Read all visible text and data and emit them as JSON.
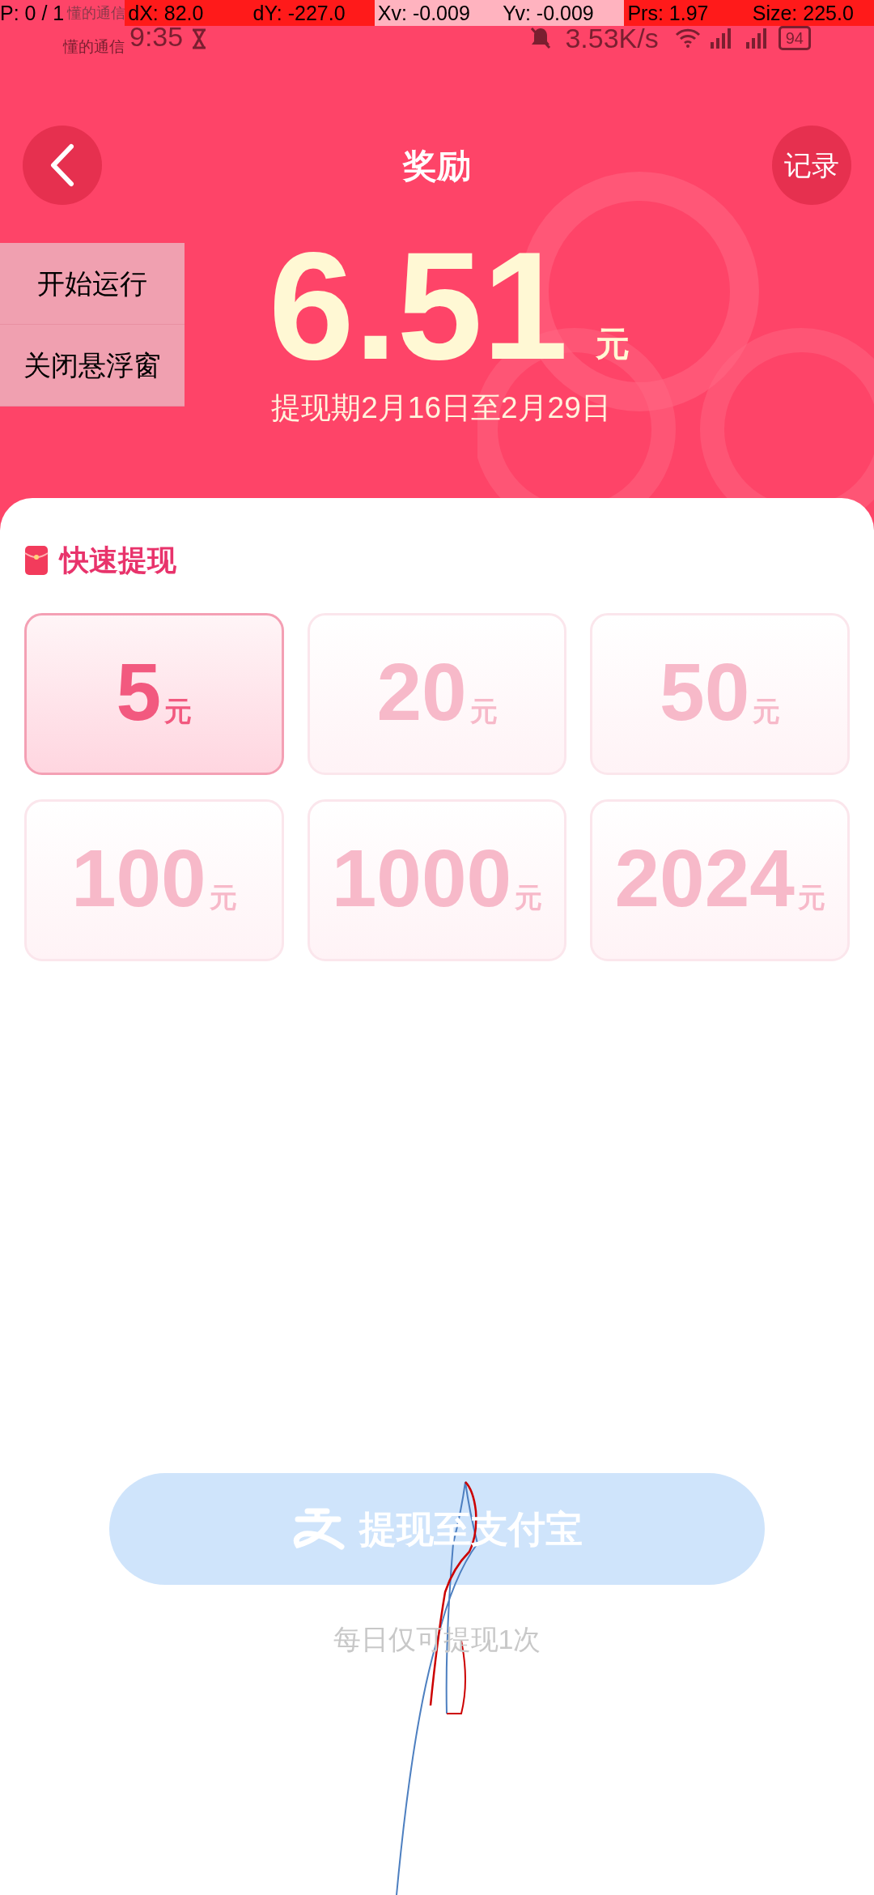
{
  "pointer_overlay": {
    "pointer": "P: 0 / 1",
    "carrier_behind": "懂的通信",
    "fields": [
      {
        "text": "dX: 82.0",
        "color": "#ff1a1a"
      },
      {
        "text": "dY: -227.0",
        "color": "#ff1a1a"
      },
      {
        "text": "Xv: -0.009",
        "color": "#ffb3bf"
      },
      {
        "text": "Yv: -0.009",
        "color": "#ffb3bf"
      },
      {
        "text": "Prs: 1.97",
        "color": "#ff1a1a"
      },
      {
        "text": "Size: 225.0",
        "color": "#ff1a1a"
      }
    ]
  },
  "status_bar": {
    "carrier": "懂的通信",
    "time": "9:35",
    "net_speed": "3.53K/s",
    "battery": "94"
  },
  "header": {
    "title": "奖励",
    "record_button": "记录"
  },
  "floating_menu": [
    "开始运行",
    "关闭悬浮窗"
  ],
  "balance": {
    "amount": "6.51",
    "unit": "元",
    "period": "提现期2月16日至2月29日"
  },
  "quick_withdraw": {
    "title": "快速提现",
    "options": [
      {
        "amount": "5",
        "unit": "元",
        "selected": true
      },
      {
        "amount": "20",
        "unit": "元",
        "selected": false
      },
      {
        "amount": "50",
        "unit": "元",
        "selected": false
      },
      {
        "amount": "100",
        "unit": "元",
        "selected": false
      },
      {
        "amount": "1000",
        "unit": "元",
        "selected": false
      },
      {
        "amount": "2024",
        "unit": "元",
        "selected": false
      }
    ]
  },
  "withdraw_button": {
    "label": "提现至支付宝",
    "disabled": true
  },
  "note": "每日仅可提现1次"
}
